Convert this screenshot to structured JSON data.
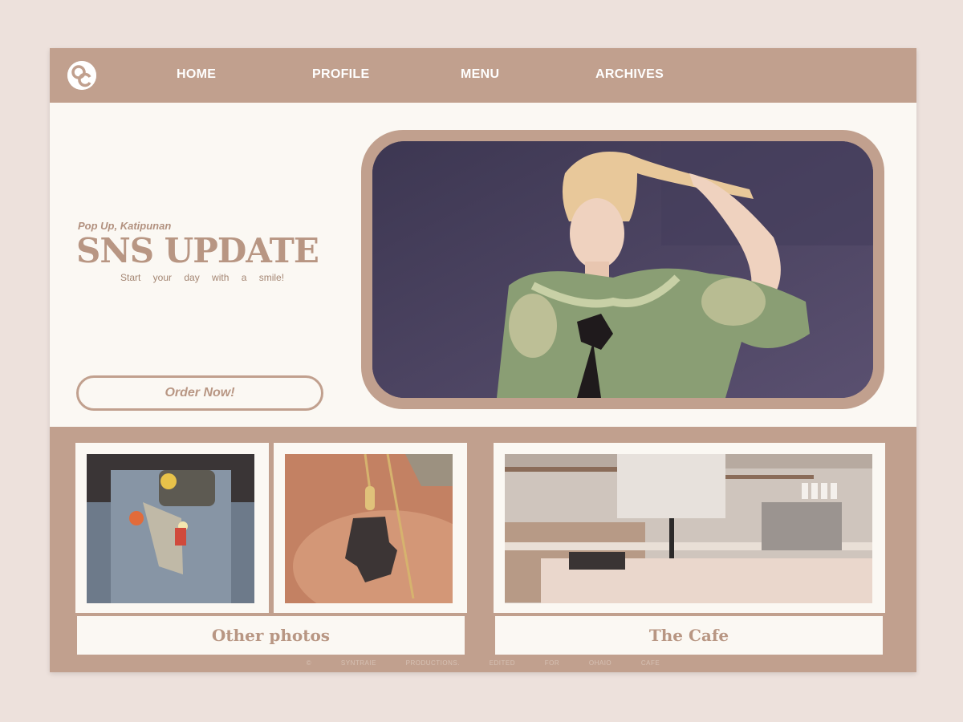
{
  "nav": {
    "items": [
      "HOME",
      "PROFILE",
      "MENU",
      "ARCHIVES"
    ]
  },
  "hero": {
    "kicker": "Pop Up, Katipunan",
    "title": "SNS UPDATE",
    "tagline": "Start your day with a smile!",
    "cta": "Order Now!"
  },
  "gallery": {
    "left_caption": "Other photos",
    "right_caption": "The Cafe"
  },
  "footer": {
    "text": "© SYNTRAIE PRODUCTIONS. EDITED FOR OHAIO CAFE"
  },
  "colors": {
    "brand": "#c1a08e",
    "cream": "#fbf8f3",
    "text_accent": "#b89683",
    "page_bg": "#ede1dc"
  },
  "icons": {
    "logo": "oc-monogram-logo"
  }
}
